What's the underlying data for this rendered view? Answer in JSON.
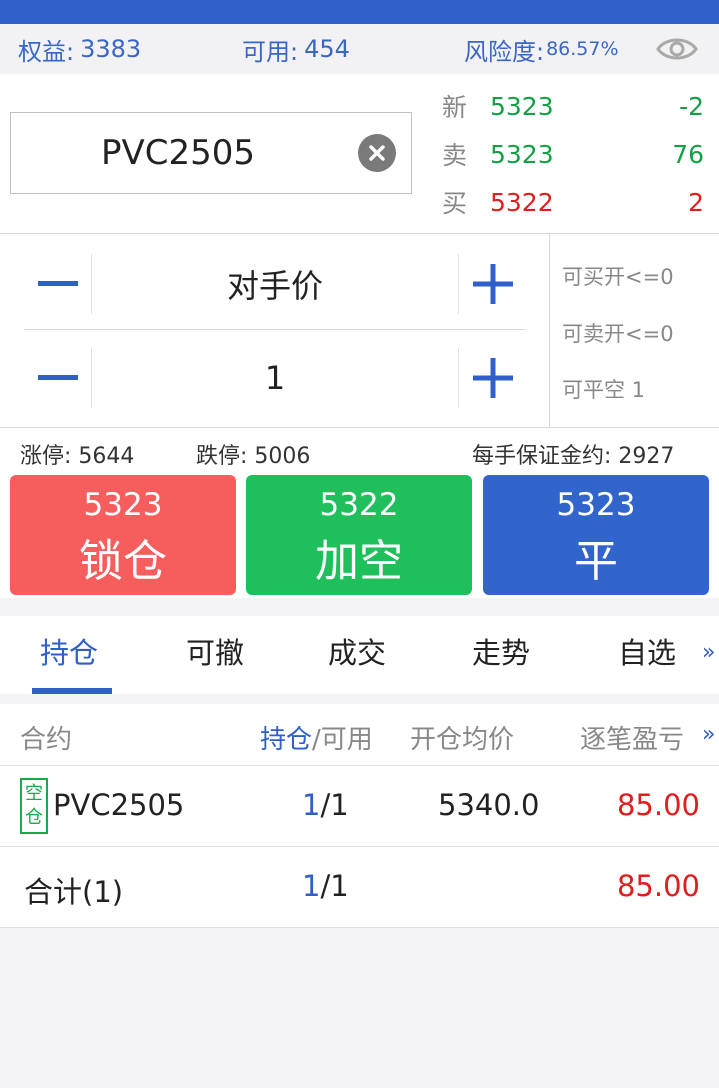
{
  "summary": {
    "equity_label": "权益:",
    "equity_value": "3383",
    "available_label": "可用:",
    "available_value": "454",
    "risk_label": "风险度:",
    "risk_value": "86.57%"
  },
  "contract": {
    "code": "PVC2505"
  },
  "quote": {
    "last_label": "新",
    "last_price": "5323",
    "last_change": "-2",
    "ask_label": "卖",
    "ask_price": "5323",
    "ask_volume": "76",
    "bid_label": "买",
    "bid_price": "5322",
    "bid_volume": "2"
  },
  "order": {
    "price_mode": "对手价",
    "quantity": "1"
  },
  "side_info": {
    "can_buy_open": "可买开<=0",
    "can_sell_open": "可卖开<=0",
    "can_close_short": "可平空 1"
  },
  "limits": {
    "limit_up": "涨停: 5644",
    "limit_down": "跌停: 5006",
    "margin": "每手保证金约: 2927"
  },
  "actions": [
    {
      "price": "5323",
      "label": "锁仓",
      "color": "#f65d5d"
    },
    {
      "price": "5322",
      "label": "加空",
      "color": "#1fbf5b"
    },
    {
      "price": "5323",
      "label": "平",
      "color": "#3265cc"
    }
  ],
  "tabs": [
    "持仓",
    "可撤",
    "成交",
    "走势",
    "自选"
  ],
  "more_symbol": "»",
  "table": {
    "headers": {
      "contract": "合约",
      "position": "持仓",
      "available": "/可用",
      "avg_price": "开仓均价",
      "pnl": "逐笔盈亏"
    },
    "rows": [
      {
        "tag_top": "空",
        "tag_bottom": "仓",
        "contract": "PVC2505",
        "position": "1",
        "available": "/1",
        "avg_price": "5340.0",
        "pnl": "85.00"
      }
    ],
    "total": {
      "label": "合计(1)",
      "position": "1",
      "available": "/1",
      "pnl": "85.00"
    }
  },
  "colors": {
    "brand_blue": "#2f5fc9",
    "up_red": "#e11d1d",
    "down_green": "#14a046"
  }
}
